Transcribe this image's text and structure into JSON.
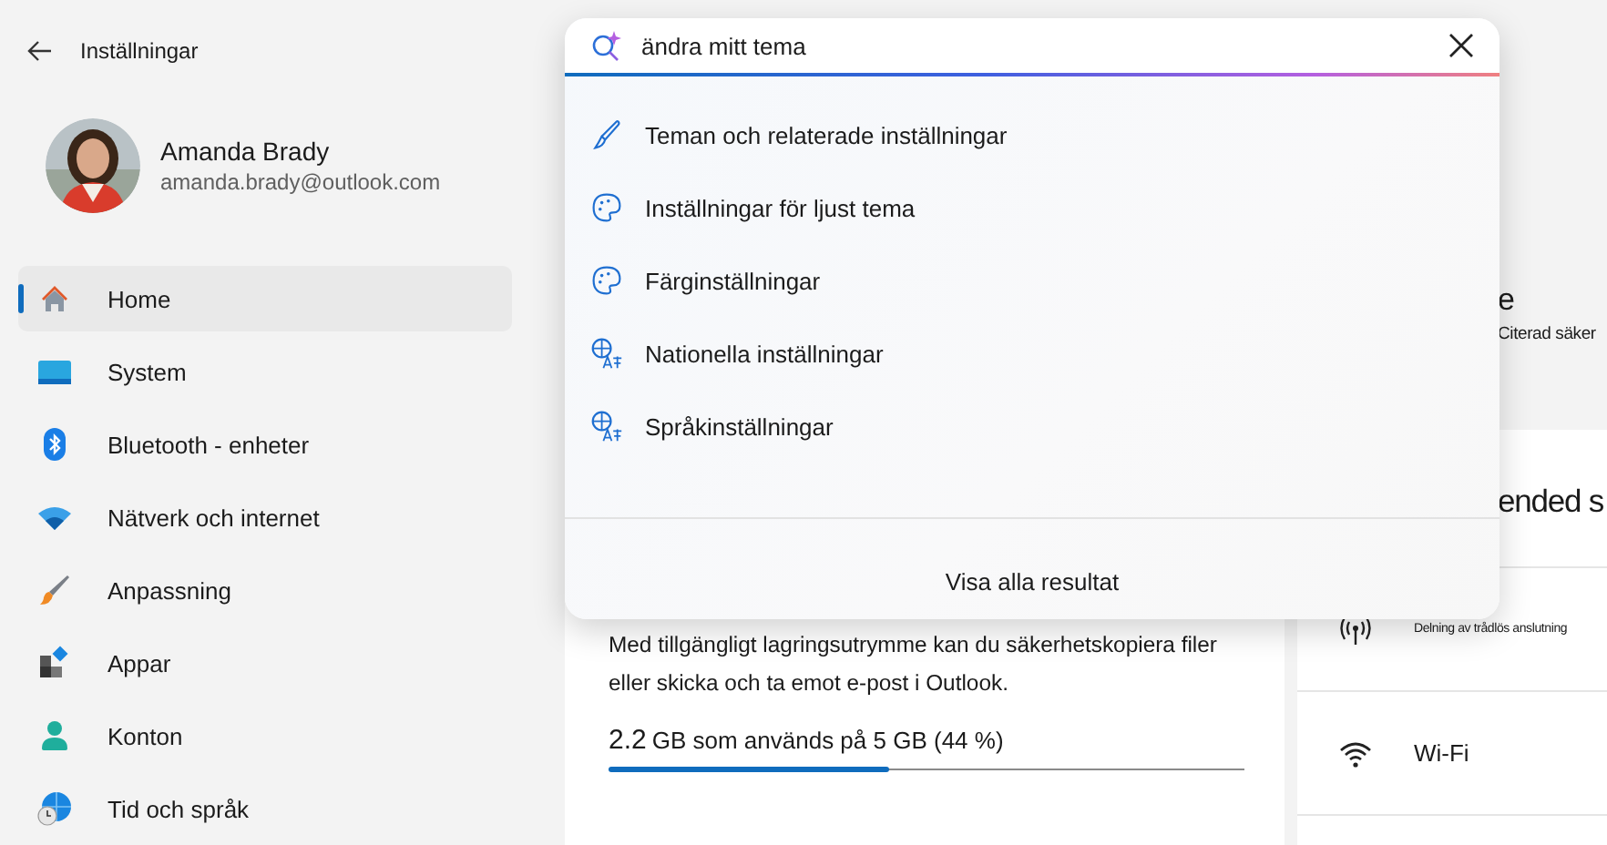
{
  "window": {
    "title": "Inställningar"
  },
  "user": {
    "name": "Amanda Brady",
    "email": "amanda.brady@outlook.com"
  },
  "nav": [
    {
      "label": "Home",
      "kind": "home",
      "selected": true
    },
    {
      "label": "System",
      "kind": "system",
      "selected": false
    },
    {
      "label": "Bluetooth - enheter",
      "kind": "bluetooth",
      "selected": false
    },
    {
      "label": "Nätverk och internet",
      "kind": "network",
      "selected": false
    },
    {
      "label": "Anpassning",
      "kind": "brush",
      "selected": false
    },
    {
      "label": "Appar",
      "kind": "apps",
      "selected": false
    },
    {
      "label": "Konton",
      "kind": "account",
      "selected": false
    },
    {
      "label": "Tid och språk",
      "kind": "time",
      "selected": false
    }
  ],
  "search": {
    "value": "ändra mitt tema",
    "results": [
      {
        "label": "Teman och relaterade inställningar",
        "kind": "brush"
      },
      {
        "label": "Inställningar för ljust tema",
        "kind": "palette"
      },
      {
        "label": "Färginställningar",
        "kind": "palette"
      },
      {
        "label": "Nationella inställningar",
        "kind": "language"
      },
      {
        "label": "Språkinställningar",
        "kind": "language"
      }
    ],
    "show_all": "Visa alla resultat"
  },
  "background": {
    "heading_fragment": "e",
    "caption_fragment": "Citerad säker",
    "recommended_heading": "ended s",
    "storage_text": "Med tillgängligt lagringsutrymme kan du säkerhetskopiera filer eller skicka och ta emot e-post i Outlook.",
    "storage_usage": {
      "amount": "2.2",
      "text": "GB som används på 5 GB (44 %)",
      "level": 0.44
    },
    "quick_settings": [
      {
        "kind": "hotspot",
        "label": "Delning av trådlös anslutning"
      },
      {
        "kind": "wifi",
        "label": "Wi-Fi"
      }
    ]
  }
}
